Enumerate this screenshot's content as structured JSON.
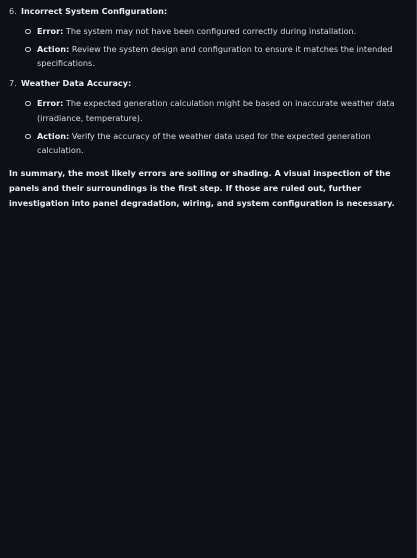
{
  "sections": [
    {
      "number": "6.",
      "title": "Incorrect System Configuration:",
      "items": [
        {
          "label": "Error:",
          "text": " The system may not have been configured correctly during installation."
        },
        {
          "label": "Action:",
          "text": " Review the system design and configuration to ensure it matches the intended specifications."
        }
      ]
    },
    {
      "number": "7.",
      "title": "Weather Data Accuracy:",
      "items": [
        {
          "label": "Error:",
          "text": " The expected generation calculation might be based on inaccurate weather data (irradiance, temperature)."
        },
        {
          "label": "Action:",
          "text": " Verify the accuracy of the weather data used for the expected generation calculation."
        }
      ]
    }
  ],
  "summary": "In summary, the most likely errors are soiling or shading. A visual inspection of the panels and their surroundings is the first step. If those are ruled out, further investigation into panel degradation, wiring, and system configuration is necessary."
}
